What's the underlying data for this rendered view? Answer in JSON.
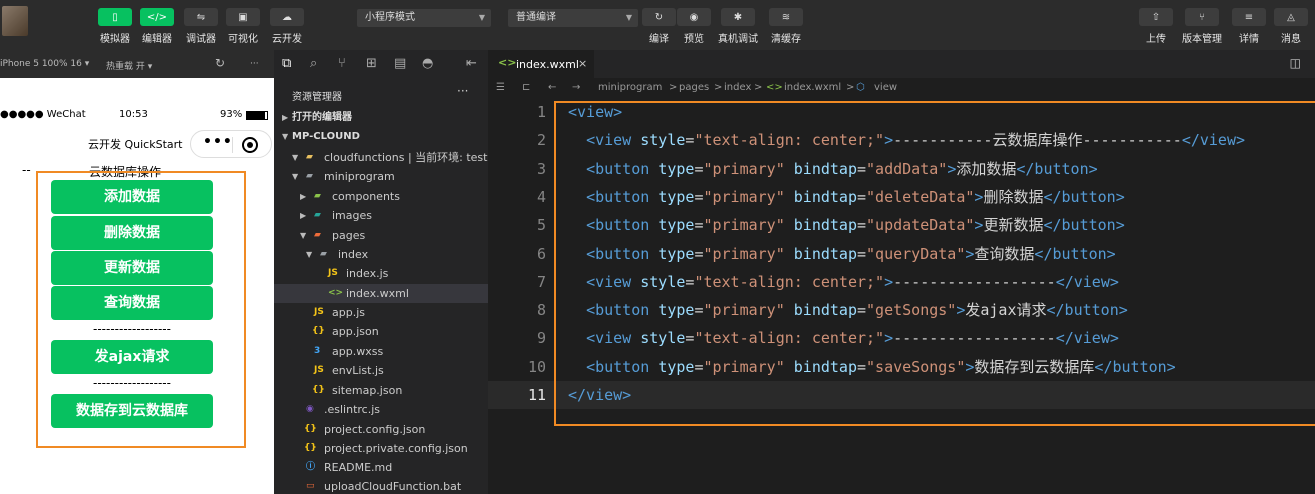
{
  "toolbar": {
    "tools": [
      {
        "label": "模拟器",
        "icon": "phone-icon"
      },
      {
        "label": "编辑器",
        "icon": "code-icon"
      },
      {
        "label": "调试器",
        "icon": "debug-icon"
      },
      {
        "label": "可视化",
        "icon": "layout-icon"
      },
      {
        "label": "云开发",
        "icon": "cloud-icon"
      }
    ],
    "mode_select": "小程序模式",
    "compile_select": "普通编译",
    "actions": [
      {
        "label": "编译",
        "icon": "refresh-icon"
      },
      {
        "label": "预览",
        "icon": "eye-icon"
      },
      {
        "label": "真机调试",
        "icon": "bug-icon"
      },
      {
        "label": "清缓存",
        "icon": "layers-icon"
      }
    ],
    "right_actions": [
      {
        "label": "上传",
        "icon": "upload-icon"
      },
      {
        "label": "版本管理",
        "icon": "branch-icon"
      },
      {
        "label": "详情",
        "icon": "menu-icon"
      },
      {
        "label": "消息",
        "icon": "bell-icon"
      }
    ]
  },
  "simulator": {
    "device": "iPhone 5 100% 16 ▾",
    "hot_reload": "热重载 开 ▾",
    "status": {
      "carrier": "●●●●● WeChat",
      "time": "10:53",
      "battery": "93%"
    },
    "nav_title": "云开发 QuickStart",
    "capsule_dots": "•••",
    "heading_dashes": "--",
    "heading": "云数据库操作",
    "buttons": [
      "添加数据",
      "删除数据",
      "更新数据",
      "查询数据",
      "发ajax请求",
      "数据存到云数据库"
    ],
    "divider": "------------------"
  },
  "explorer": {
    "title": "资源管理器",
    "more": "···",
    "open_editors": "打开的编辑器",
    "root": "MP-CLOUND",
    "items": [
      {
        "name": "cloudfunctions | 当前环境: test",
        "icon": "folder-icon"
      },
      {
        "name": "miniprogram",
        "icon": "folder-icon"
      },
      {
        "name": "components",
        "icon": "folder-icon"
      },
      {
        "name": "images",
        "icon": "folder-icon"
      },
      {
        "name": "pages",
        "icon": "folder-icon"
      },
      {
        "name": "index",
        "icon": "folder-icon"
      },
      {
        "name": "index.js",
        "icon": "js-file-icon"
      },
      {
        "name": "index.wxml",
        "icon": "wxml-file-icon"
      },
      {
        "name": "app.js",
        "icon": "js-file-icon"
      },
      {
        "name": "app.json",
        "icon": "json-file-icon"
      },
      {
        "name": "app.wxss",
        "icon": "css-file-icon"
      },
      {
        "name": "envList.js",
        "icon": "js-file-icon"
      },
      {
        "name": "sitemap.json",
        "icon": "json-file-icon"
      },
      {
        "name": ".eslintrc.js",
        "icon": "eslint-file-icon"
      },
      {
        "name": "project.config.json",
        "icon": "json-file-icon"
      },
      {
        "name": "project.private.config.json",
        "icon": "json-file-icon"
      },
      {
        "name": "README.md",
        "icon": "info-file-icon"
      },
      {
        "name": "uploadCloudFunction.bat",
        "icon": "bat-file-icon"
      }
    ]
  },
  "editor": {
    "tab": "index.wxml",
    "tab_close": "×",
    "breadcrumbs": [
      "miniprogram",
      ">",
      "pages",
      ">",
      "index",
      ">",
      "index.wxml",
      ">",
      "view"
    ],
    "lines": [
      {
        "n": "1",
        "parts": [
          [
            "t",
            "<view>"
          ]
        ]
      },
      {
        "n": "2",
        "parts": [
          [
            "p",
            "  "
          ],
          [
            "t",
            "<view "
          ],
          [
            "a",
            "style"
          ],
          [
            "p",
            "="
          ],
          [
            "s",
            "\"text-align: center;\""
          ],
          [
            "t",
            ">"
          ],
          [
            "p",
            "-----------云数据库操作-----------"
          ],
          [
            "t",
            "</view>"
          ]
        ]
      },
      {
        "n": "3",
        "parts": [
          [
            "p",
            "  "
          ],
          [
            "t",
            "<button "
          ],
          [
            "a",
            "type"
          ],
          [
            "p",
            "="
          ],
          [
            "s",
            "\"primary\""
          ],
          [
            "p",
            " "
          ],
          [
            "a",
            "bindtap"
          ],
          [
            "p",
            "="
          ],
          [
            "s",
            "\"addData\""
          ],
          [
            "t",
            ">"
          ],
          [
            "p",
            "添加数据"
          ],
          [
            "t",
            "</button>"
          ]
        ]
      },
      {
        "n": "4",
        "parts": [
          [
            "p",
            "  "
          ],
          [
            "t",
            "<button "
          ],
          [
            "a",
            "type"
          ],
          [
            "p",
            "="
          ],
          [
            "s",
            "\"primary\""
          ],
          [
            "p",
            " "
          ],
          [
            "a",
            "bindtap"
          ],
          [
            "p",
            "="
          ],
          [
            "s",
            "\"deleteData\""
          ],
          [
            "t",
            ">"
          ],
          [
            "p",
            "删除数据"
          ],
          [
            "t",
            "</button>"
          ]
        ]
      },
      {
        "n": "5",
        "parts": [
          [
            "p",
            "  "
          ],
          [
            "t",
            "<button "
          ],
          [
            "a",
            "type"
          ],
          [
            "p",
            "="
          ],
          [
            "s",
            "\"primary\""
          ],
          [
            "p",
            " "
          ],
          [
            "a",
            "bindtap"
          ],
          [
            "p",
            "="
          ],
          [
            "s",
            "\"updateData\""
          ],
          [
            "t",
            ">"
          ],
          [
            "p",
            "更新数据"
          ],
          [
            "t",
            "</button>"
          ]
        ]
      },
      {
        "n": "6",
        "parts": [
          [
            "p",
            "  "
          ],
          [
            "t",
            "<button "
          ],
          [
            "a",
            "type"
          ],
          [
            "p",
            "="
          ],
          [
            "s",
            "\"primary\""
          ],
          [
            "p",
            " "
          ],
          [
            "a",
            "bindtap"
          ],
          [
            "p",
            "="
          ],
          [
            "s",
            "\"queryData\""
          ],
          [
            "t",
            ">"
          ],
          [
            "p",
            "查询数据"
          ],
          [
            "t",
            "</button>"
          ]
        ]
      },
      {
        "n": "7",
        "parts": [
          [
            "p",
            "  "
          ],
          [
            "t",
            "<view "
          ],
          [
            "a",
            "style"
          ],
          [
            "p",
            "="
          ],
          [
            "s",
            "\"text-align: center;\""
          ],
          [
            "t",
            ">"
          ],
          [
            "p",
            "------------------"
          ],
          [
            "t",
            "</view>"
          ]
        ]
      },
      {
        "n": "8",
        "parts": [
          [
            "p",
            "  "
          ],
          [
            "t",
            "<button "
          ],
          [
            "a",
            "type"
          ],
          [
            "p",
            "="
          ],
          [
            "s",
            "\"primary\""
          ],
          [
            "p",
            " "
          ],
          [
            "a",
            "bindtap"
          ],
          [
            "p",
            "="
          ],
          [
            "s",
            "\"getSongs\""
          ],
          [
            "t",
            ">"
          ],
          [
            "p",
            "发ajax请求"
          ],
          [
            "t",
            "</button>"
          ]
        ]
      },
      {
        "n": "9",
        "parts": [
          [
            "p",
            "  "
          ],
          [
            "t",
            "<view "
          ],
          [
            "a",
            "style"
          ],
          [
            "p",
            "="
          ],
          [
            "s",
            "\"text-align: center;\""
          ],
          [
            "t",
            ">"
          ],
          [
            "p",
            "------------------"
          ],
          [
            "t",
            "</view>"
          ]
        ]
      },
      {
        "n": "10",
        "parts": [
          [
            "p",
            "  "
          ],
          [
            "t",
            "<button "
          ],
          [
            "a",
            "type"
          ],
          [
            "p",
            "="
          ],
          [
            "s",
            "\"primary\""
          ],
          [
            "p",
            " "
          ],
          [
            "a",
            "bindtap"
          ],
          [
            "p",
            "="
          ],
          [
            "s",
            "\"saveSongs\""
          ],
          [
            "t",
            ">"
          ],
          [
            "p",
            "数据存到云数据库"
          ],
          [
            "t",
            "</button>"
          ]
        ]
      },
      {
        "n": "11",
        "parts": [
          [
            "t",
            "</view>"
          ]
        ]
      }
    ]
  },
  "colors": {
    "accent_green": "#07c160",
    "highlight_orange": "#f08a24"
  }
}
